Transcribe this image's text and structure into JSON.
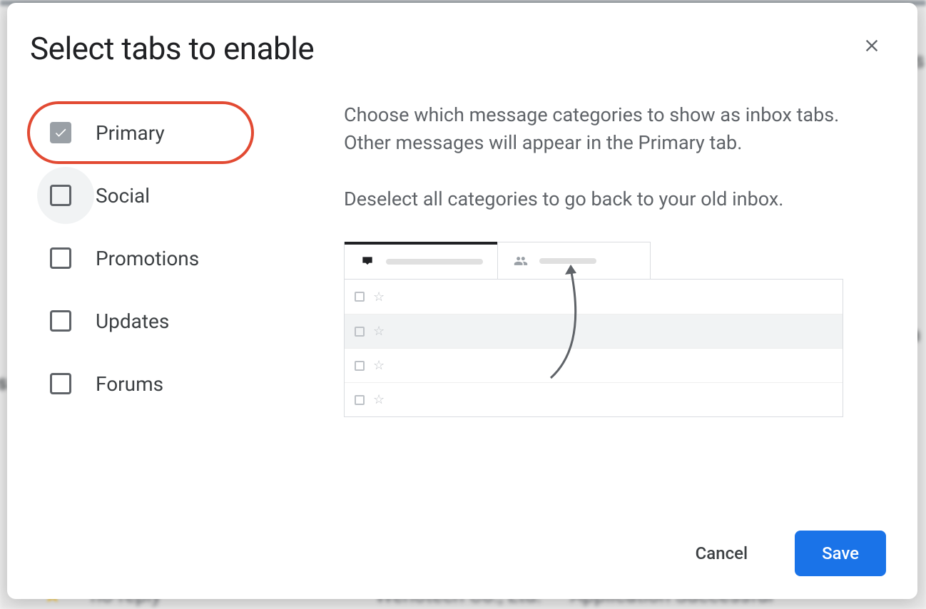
{
  "dialog": {
    "title": "Select tabs to enable",
    "options": [
      {
        "id": "primary",
        "label": "Primary",
        "checked": true,
        "locked": true,
        "highlighted": true
      },
      {
        "id": "social",
        "label": "Social",
        "checked": false,
        "locked": false,
        "hover": true
      },
      {
        "id": "promotions",
        "label": "Promotions",
        "checked": false,
        "locked": false
      },
      {
        "id": "updates",
        "label": "Updates",
        "checked": false,
        "locked": false
      },
      {
        "id": "forums",
        "label": "Forums",
        "checked": false,
        "locked": false
      }
    ],
    "description_line1": "Choose which message categories to show as inbox tabs. Other messages will appear in the Primary tab.",
    "description_line2": "Deselect all categories to go back to your old inbox.",
    "buttons": {
      "cancel": "Cancel",
      "save": "Save"
    }
  },
  "background": {
    "sender": "no-reply",
    "company": "Wenotech Co., Ltd.",
    "subject_fragment": "Application Successful"
  }
}
